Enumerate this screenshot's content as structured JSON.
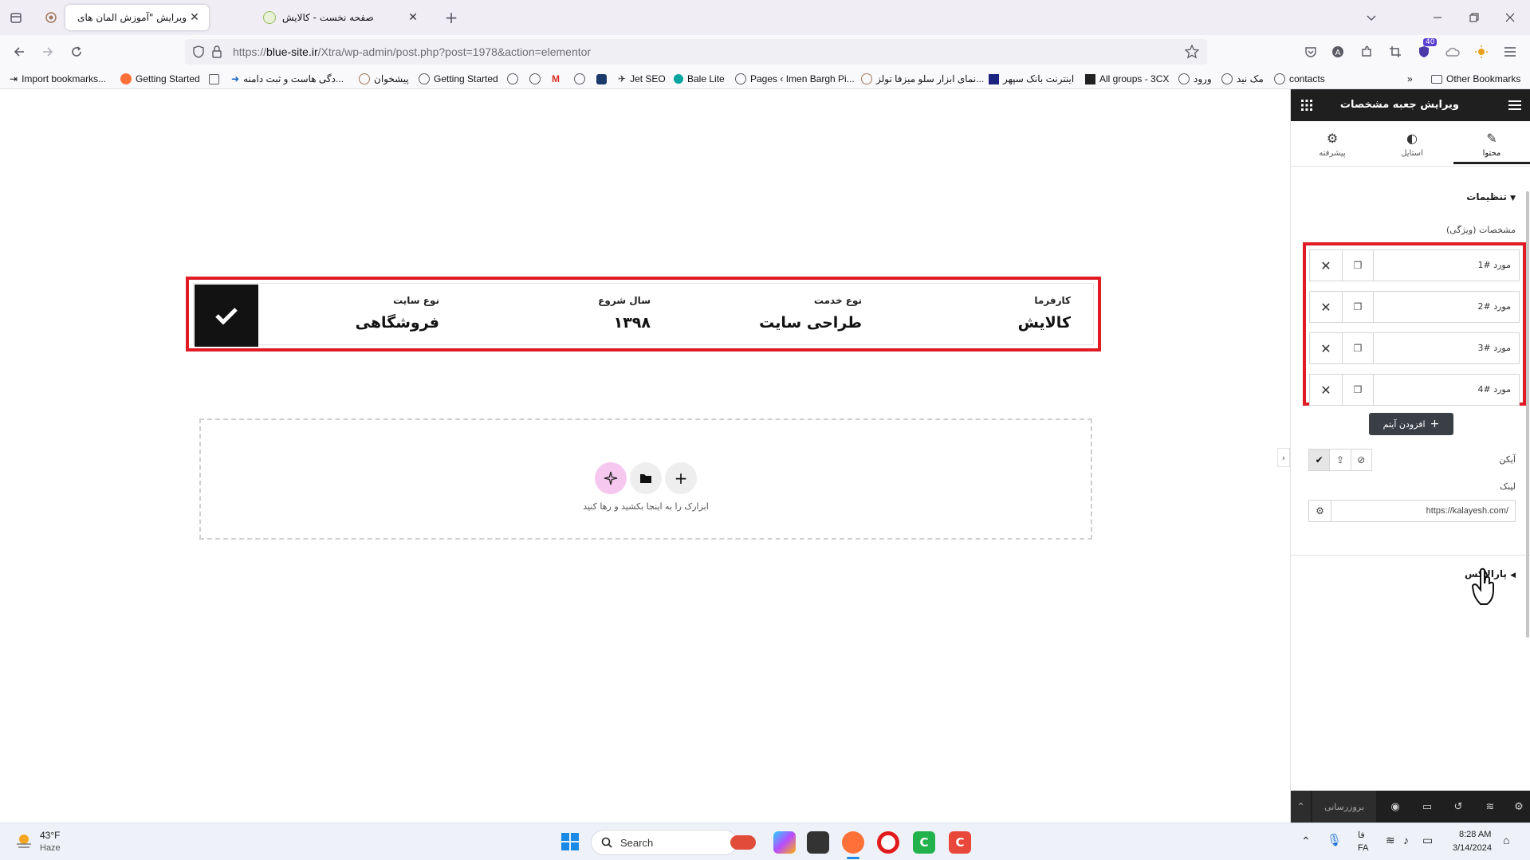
{
  "browser": {
    "tabs": [
      {
        "title": "ویرایش \"آموزش المان های اکسترا –",
        "active": true
      },
      {
        "title": "صفحه نخست - کالایش",
        "active": false
      }
    ],
    "url_prefix": "https://",
    "url_domain": "blue-site.ir",
    "url_path": "/Xtra/wp-admin/post.php?post=1978&action=elementor",
    "extension_badge": "40",
    "bookmarks": [
      "Import bookmarks...",
      "Getting Started",
      "...دگی هاست و ثبت دامنه",
      "پیشخوان",
      "Getting Started",
      "Jet SEO",
      "Bale Lite",
      "Pages ‹ Imen Bargh Pi...",
      "...نمای ابزار سلو میزفا تولز",
      "اینترنت بانک سپهر",
      "All groups - 3CX",
      "ورود",
      "مک نید",
      "contacts"
    ],
    "other_bookmarks": "Other Bookmarks"
  },
  "canvas": {
    "specs": [
      {
        "key": "کارفرما",
        "value": "کالایش"
      },
      {
        "key": "نوع خدمت",
        "value": "طراحی سایت"
      },
      {
        "key": "سال شروع",
        "value": "۱۳۹۸"
      },
      {
        "key": "نوع سایت",
        "value": "فروشگاهی"
      }
    ],
    "dropzone_text": "ابزارک را به اینجا بکشید و رها کنید"
  },
  "panel": {
    "title": "ویرایش جعبه مشخصات",
    "tabs": {
      "content": "محتوا",
      "style": "استایل",
      "advanced": "پیشرفته"
    },
    "section_settings": "تنظیمات",
    "repeater_label": "مشخصات (ویژگی)",
    "items": [
      "مورد #1",
      "مورد #2",
      "مورد #3",
      "مورد #4"
    ],
    "add_item": "افزودن آیتم",
    "icon_label": "آیکن",
    "link_label": "لینک",
    "link_value": "https://kalayesh.com/",
    "section_advanced": "پارالاکس",
    "update_button": "بروزرسانی"
  },
  "taskbar": {
    "weather_temp": "43°F",
    "weather_desc": "Haze",
    "search_placeholder": "Search",
    "lang_top": "فا",
    "lang_bottom": "FA",
    "time": "8:28 AM",
    "date": "3/14/2024"
  },
  "colors": {
    "highlight_red": "#e01b24",
    "panel_dark": "#1f1f1f",
    "check_block": "#121212"
  }
}
